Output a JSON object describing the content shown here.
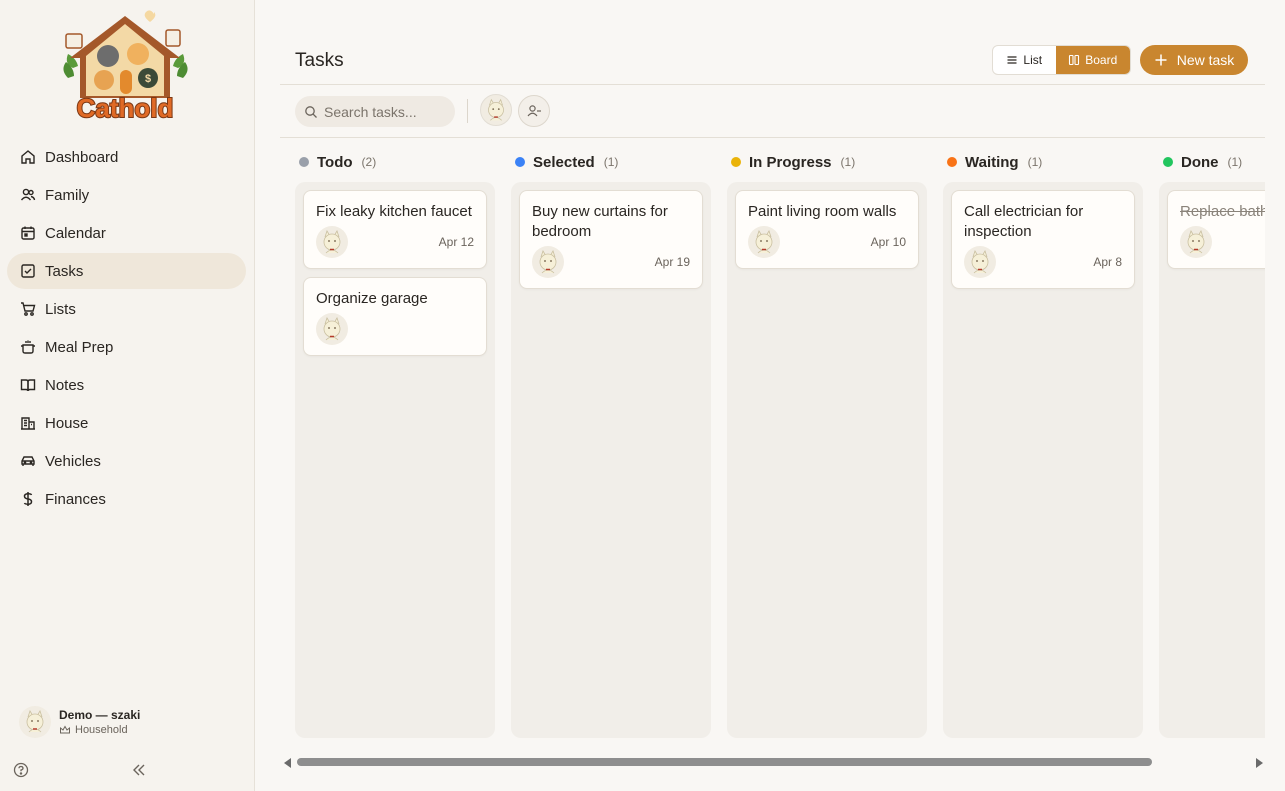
{
  "app": {
    "logo_text": "Cathold"
  },
  "sidebar": {
    "items": [
      {
        "label": "Dashboard",
        "icon": "home-icon"
      },
      {
        "label": "Family",
        "icon": "users-icon"
      },
      {
        "label": "Calendar",
        "icon": "calendar-icon"
      },
      {
        "label": "Tasks",
        "icon": "checkbox-icon",
        "active": true
      },
      {
        "label": "Lists",
        "icon": "cart-icon"
      },
      {
        "label": "Meal Prep",
        "icon": "pot-icon"
      },
      {
        "label": "Notes",
        "icon": "book-icon"
      },
      {
        "label": "House",
        "icon": "building-icon"
      },
      {
        "label": "Vehicles",
        "icon": "car-icon"
      },
      {
        "label": "Finances",
        "icon": "dollar-icon"
      }
    ],
    "user": {
      "name": "Demo — szaki",
      "role": "Household",
      "role_icon": "crown-icon"
    }
  },
  "header": {
    "title": "Tasks",
    "view_list_label": "List",
    "view_board_label": "Board",
    "new_task_label": "New task"
  },
  "toolbar": {
    "search_placeholder": "Search tasks..."
  },
  "board": {
    "columns": [
      {
        "title": "Todo",
        "count": "(2)",
        "color": "#9aa0aa",
        "cards": [
          {
            "title": "Fix leaky kitchen faucet",
            "date": "Apr 12"
          },
          {
            "title": "Organize garage",
            "date": ""
          }
        ]
      },
      {
        "title": "Selected",
        "count": "(1)",
        "color": "#3b82f6",
        "cards": [
          {
            "title": "Buy new curtains for bedroom",
            "date": "Apr 19"
          }
        ]
      },
      {
        "title": "In Progress",
        "count": "(1)",
        "color": "#eab308",
        "cards": [
          {
            "title": "Paint living room walls",
            "date": "Apr 10"
          }
        ]
      },
      {
        "title": "Waiting",
        "count": "(1)",
        "color": "#f97316",
        "cards": [
          {
            "title": "Call electrician for inspection",
            "date": "Apr 8"
          }
        ]
      },
      {
        "title": "Done",
        "count": "(1)",
        "color": "#22c55e",
        "cards": [
          {
            "title": "Replace bathroom light",
            "date": "",
            "done": true
          }
        ]
      }
    ]
  },
  "colors": {
    "accent": "#c9862f",
    "active_nav_bg": "#efe7da"
  }
}
